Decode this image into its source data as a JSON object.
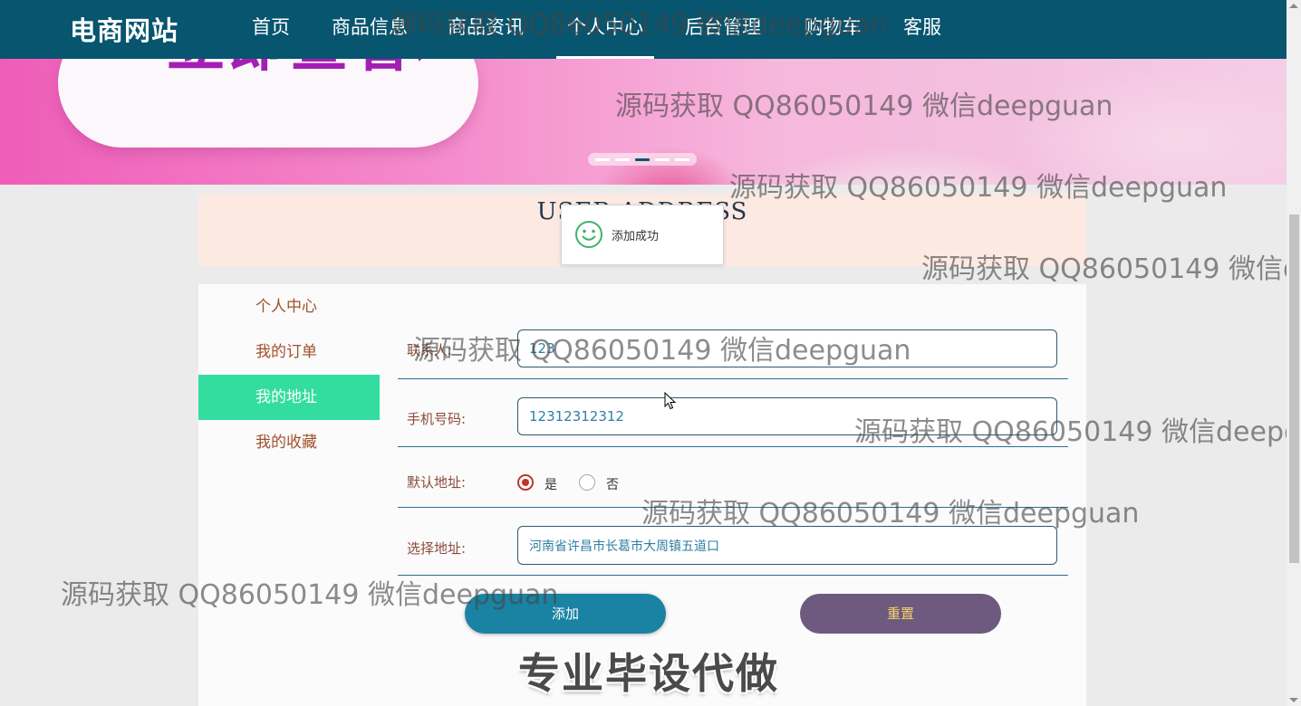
{
  "header": {
    "brand": "电商网站",
    "nav": [
      "首页",
      "商品信息",
      "商品资讯",
      "个人中心",
      "后台管理",
      "购物车",
      "客服"
    ],
    "active_nav": "个人中心"
  },
  "banner": {
    "cta": "立即查看",
    "cta_arrow": "›",
    "slides": 5,
    "active_slide": 3
  },
  "section": {
    "title": "USER ADDRESS"
  },
  "toast": {
    "message": "添加成功",
    "icon": "smile-icon"
  },
  "sidebar": {
    "items": [
      {
        "label": "个人中心"
      },
      {
        "label": "我的订单"
      },
      {
        "label": "我的地址"
      },
      {
        "label": "我的收藏"
      }
    ],
    "active": "我的地址"
  },
  "form": {
    "contact": {
      "label": "联系人:",
      "value": "123"
    },
    "phone": {
      "label": "手机号码:",
      "value": "12312312312"
    },
    "default_address": {
      "label": "默认地址:",
      "options": [
        "是",
        "否"
      ],
      "selected": "是"
    },
    "address": {
      "label": "选择地址:",
      "value": "河南省许昌市长葛市大周镇五道口"
    },
    "add_button": "添加",
    "reset_button": "重置"
  },
  "overlays": {
    "watermark": "源码获取 QQ86050149 微信deepguan",
    "slogan": "专业毕设代做"
  },
  "colors": {
    "nav_bg": "#07556f",
    "active_side": "#33dda0",
    "add_button": "#1a82a3",
    "reset_button": "#6e5a7e",
    "section_bg": "#fbe9e2"
  }
}
